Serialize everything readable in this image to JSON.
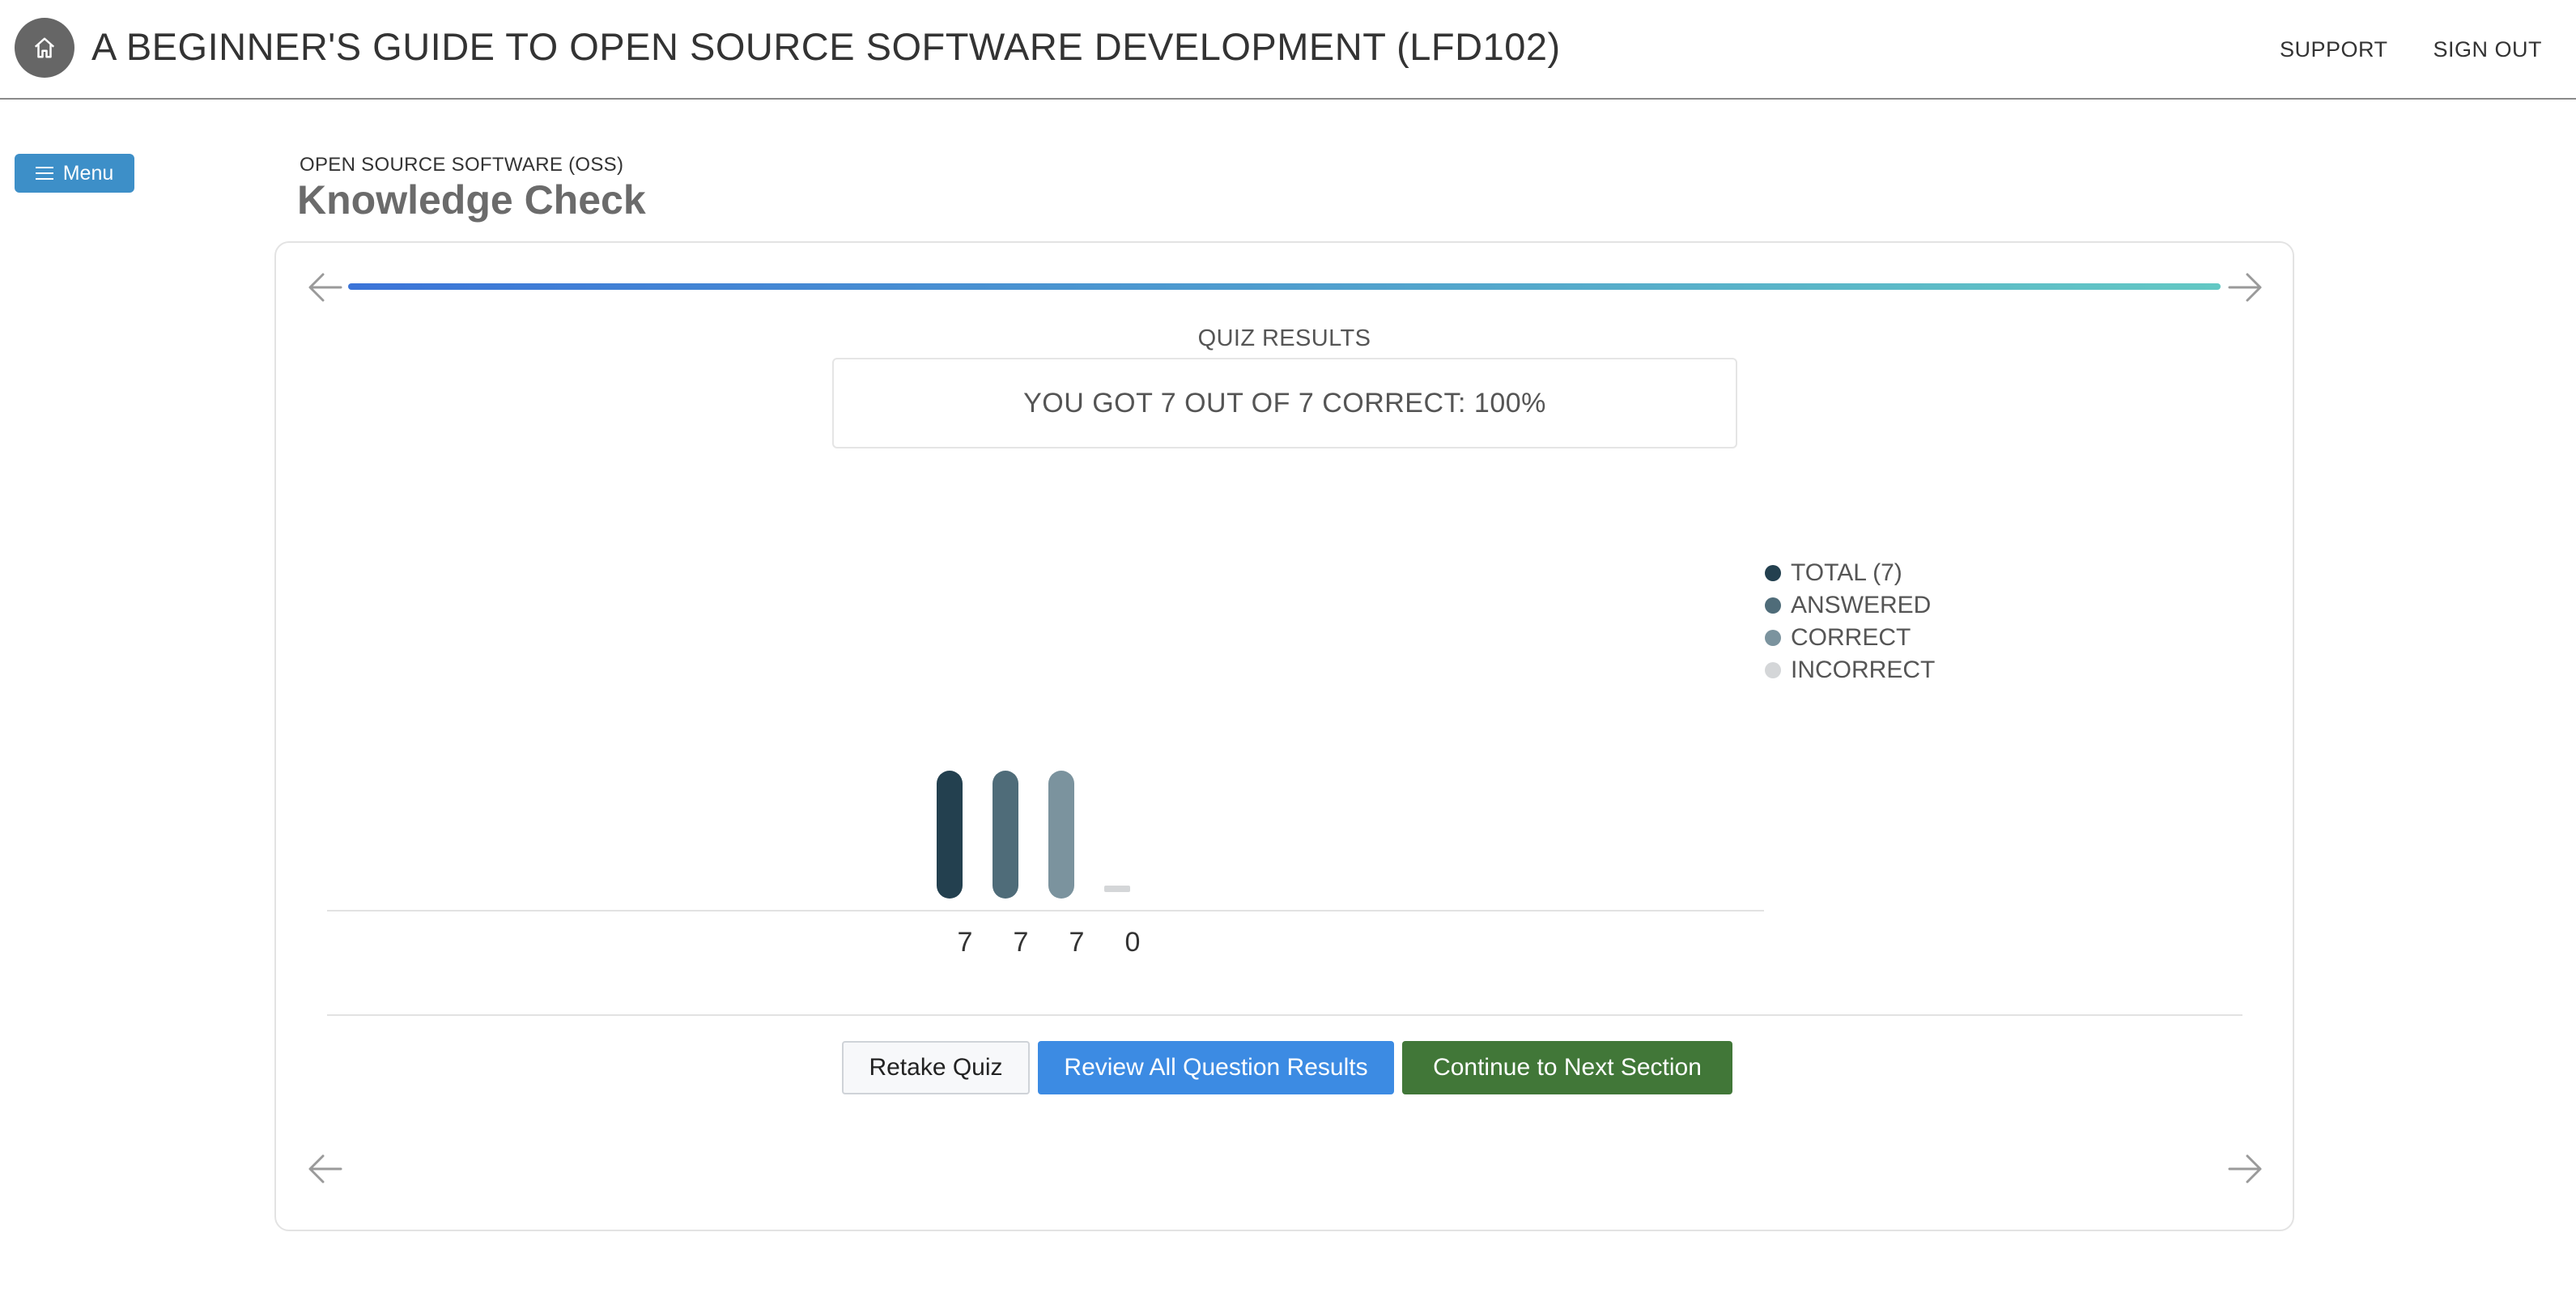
{
  "header": {
    "course_title": "A BEGINNER'S GUIDE TO OPEN SOURCE SOFTWARE DEVELOPMENT (LFD102)",
    "support_label": "SUPPORT",
    "signout_label": "SIGN OUT"
  },
  "menu": {
    "label": "Menu"
  },
  "section": {
    "label": "OPEN SOURCE SOFTWARE (OSS)",
    "title": "Knowledge Check"
  },
  "quiz": {
    "results_label": "QUIZ RESULTS",
    "score_text": "YOU GOT 7 OUT OF 7 CORRECT: 100%",
    "progress": 1.0
  },
  "buttons": {
    "retake": "Retake Quiz",
    "review": "Review All Question Results",
    "continue": "Continue to Next Section"
  },
  "colors": {
    "total": "#23404f",
    "answered": "#4f6c79",
    "correct": "#7b939e",
    "incorrect": "#d4d6d8",
    "menu_blue": "#3d8fc8",
    "review_blue": "#3c8be3",
    "continue_green": "#417738"
  },
  "chart_data": {
    "type": "bar",
    "categories": [
      "TOTAL (7)",
      "ANSWERED",
      "CORRECT",
      "INCORRECT"
    ],
    "values": [
      7,
      7,
      7,
      0
    ],
    "value_labels": [
      "7",
      "7",
      "7",
      "0"
    ],
    "ylim": [
      0,
      7
    ],
    "legend_position": "right",
    "grid": false
  }
}
